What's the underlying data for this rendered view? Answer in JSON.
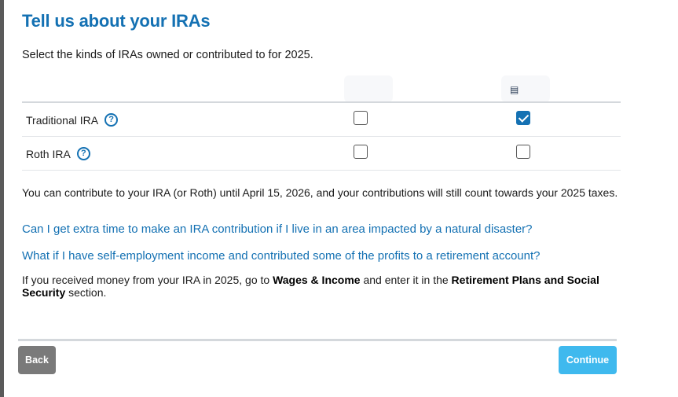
{
  "page": {
    "title": "Tell us about your IRAs",
    "intro": "Select the kinds of IRAs owned or contributed to for 2025."
  },
  "table": {
    "columns": [
      {
        "owner_icon": "id-card-icon"
      },
      {
        "owner_icon": "id-card-icon"
      }
    ],
    "rows": [
      {
        "label": "Traditional IRA",
        "help": "?",
        "col1_checked": false,
        "col2_checked": true
      },
      {
        "label": "Roth IRA",
        "help": "?",
        "col1_checked": false,
        "col2_checked": false
      }
    ]
  },
  "info": {
    "contribution_note": "You can contribute to your IRA (or Roth) until April 15, 2026, and your contributions will still count towards your 2025 taxes.",
    "faq_1": "Can I get extra time to make an IRA contribution if I live in an area impacted by a natural disaster?",
    "faq_2": "What if I have self-employment income and contributed some of the profits to a retirement account?",
    "received_prefix": "If you received money from your IRA in 2025, go to ",
    "wages_link": "Wages & Income",
    "received_middle": " and enter it in the ",
    "retirement_section": "Retirement Plans and Social Security",
    "received_suffix": " section."
  },
  "footer": {
    "back_label": "Back",
    "continue_label": "Continue"
  },
  "colors": {
    "accent": "#1471b3",
    "continue": "#3fb9ee",
    "back": "#7a7a7a"
  }
}
